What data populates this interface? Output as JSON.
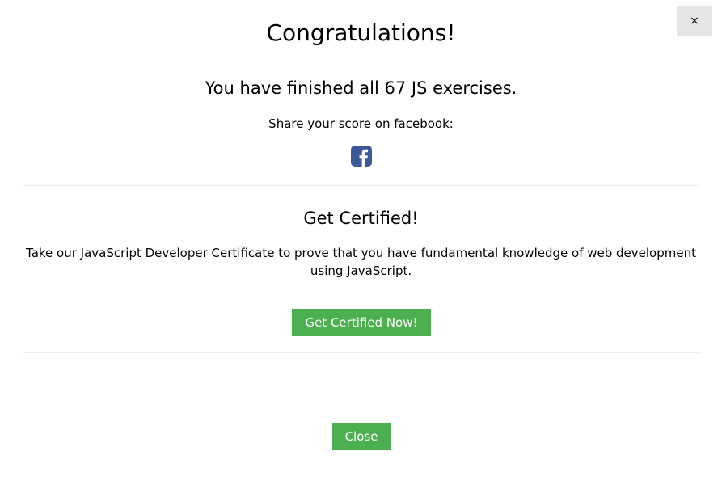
{
  "modal": {
    "close_x": "×",
    "title": "Congratulations!",
    "finished_text": "You have finished all 67 JS exercises.",
    "share_text": "Share your score on facebook:",
    "share_icon": "facebook-icon",
    "certificate": {
      "title": "Get Certified!",
      "text": "Take our JavaScript Developer Certificate to prove that you have fundamental knowledge of web development using JavaScript.",
      "button_label": "Get Certified Now!"
    },
    "close_button_label": "Close"
  },
  "colors": {
    "accent": "#4CAF50",
    "facebook": "#3B5998",
    "close_x_bg": "#e6e6e6",
    "divider": "#eeeeee"
  }
}
